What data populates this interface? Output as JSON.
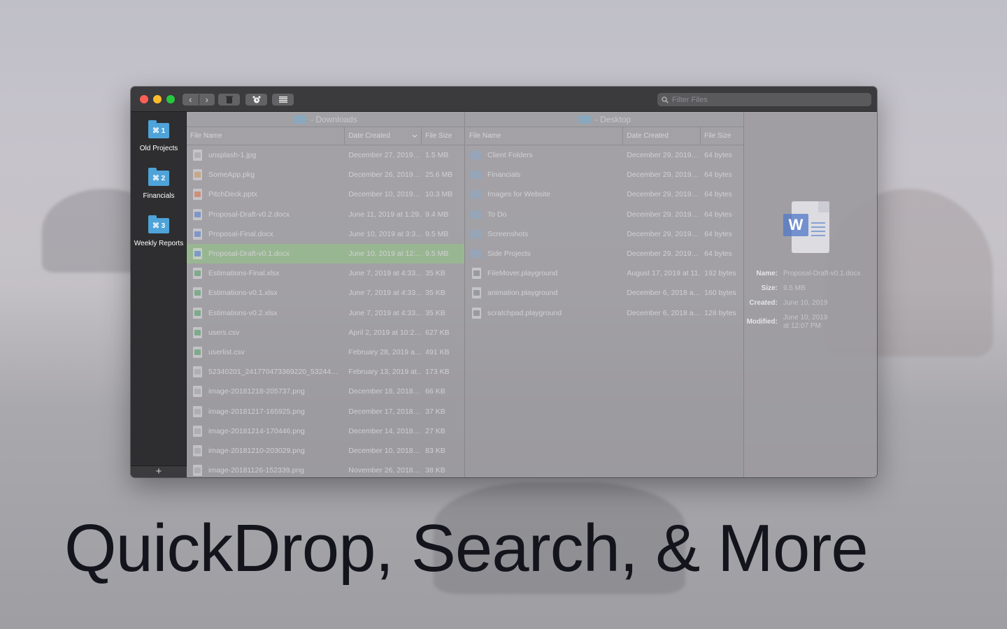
{
  "toolbar": {
    "search_placeholder": "Filter Files",
    "back_glyph": "‹",
    "forward_glyph": "›"
  },
  "sidebar": {
    "items": [
      {
        "shortcut": "⌘ 1",
        "label": "Old Projects"
      },
      {
        "shortcut": "⌘ 2",
        "label": "Financials"
      },
      {
        "shortcut": "⌘ 3",
        "label": "Weekly Reports"
      }
    ],
    "add_label": "+"
  },
  "left_pane": {
    "title": "- Downloads",
    "columns": {
      "name": "File Name",
      "date": "Date Created",
      "size": "File Size"
    },
    "rows": [
      {
        "name": "unsplash-1.jpg",
        "date": "December 27, 2019…",
        "size": "1.5 MB"
      },
      {
        "name": "SomeApp.pkg",
        "date": "December 26, 2019…",
        "size": "25.6 MB"
      },
      {
        "name": "PitchDeck.pptx",
        "date": "December 10, 2019…",
        "size": "10.3 MB"
      },
      {
        "name": "Proposal-Draft-v0.2.docx",
        "date": "June 11, 2019 at 1:29…",
        "size": "9.4 MB"
      },
      {
        "name": "Proposal-Final.docx",
        "date": "June 10, 2019 at 3:3…",
        "size": "9.5 MB"
      },
      {
        "name": "Proposal-Draft-v0.1.docx",
        "date": "June 10, 2019 at 12:…",
        "size": "9.5 MB"
      },
      {
        "name": "Estimations-Final.xlsx",
        "date": "June 7, 2019 at 4:33…",
        "size": "35 KB"
      },
      {
        "name": "Estimations-v0.1.xlsx",
        "date": "June 7, 2019 at 4:33…",
        "size": "35 KB"
      },
      {
        "name": "Estimations-v0.2.xlsx",
        "date": "June 7, 2019 at 4:33…",
        "size": "35 KB"
      },
      {
        "name": "users.csv",
        "date": "April 2, 2019 at 10:2…",
        "size": "627 KB"
      },
      {
        "name": "userlist.csv",
        "date": "February 28, 2019 a…",
        "size": "491 KB"
      },
      {
        "name": "52340201_241770473369220_53244…",
        "date": "February 13, 2019 at…",
        "size": "173 KB"
      },
      {
        "name": "image-20181218-205737.png",
        "date": "December 18, 2018…",
        "size": "66 KB"
      },
      {
        "name": "image-20181217-165925.png",
        "date": "December 17, 2018…",
        "size": "37 KB"
      },
      {
        "name": "image-20181214-170446.png",
        "date": "December 14, 2018…",
        "size": "27 KB"
      },
      {
        "name": "image-20181210-203029.png",
        "date": "December 10, 2018…",
        "size": "83 KB"
      },
      {
        "name": "image-20181126-152339.png",
        "date": "November 26, 2018…",
        "size": "38 KB"
      }
    ]
  },
  "right_pane": {
    "title": "- Desktop",
    "columns": {
      "name": "File Name",
      "date": "Date Created",
      "size": "File Size"
    },
    "rows": [
      {
        "name": "Client Folders",
        "date": "December 29, 2019…",
        "size": "64 bytes"
      },
      {
        "name": "Financials",
        "date": "December 29, 2019…",
        "size": "64 bytes"
      },
      {
        "name": "Images for Website",
        "date": "December 29, 2019…",
        "size": "64 bytes"
      },
      {
        "name": "To Do",
        "date": "December 29, 2019…",
        "size": "64 bytes"
      },
      {
        "name": "Screenshots",
        "date": "December 29, 2019…",
        "size": "64 bytes"
      },
      {
        "name": "Side Projects",
        "date": "December 29, 2019…",
        "size": "64 bytes"
      },
      {
        "name": "FileMover.playground",
        "date": "August 17, 2019 at 11…",
        "size": "192 bytes"
      },
      {
        "name": "animation.playground",
        "date": "December 6, 2018 a…",
        "size": "160 bytes"
      },
      {
        "name": "scratchpad.playground",
        "date": "December 6, 2018 a…",
        "size": "128 bytes"
      }
    ]
  },
  "info": {
    "icon_letter": "W",
    "name_label": "Name:",
    "name_value": "Proposal-Draft-v0.1.docx",
    "size_label": "Size:",
    "size_value": "9.5 MB",
    "created_label": "Created:",
    "created_value": "June 10, 2019",
    "modified_label": "Modified:",
    "modified_value": "June 10, 2019 at 12:07 PM"
  },
  "headline": "QuickDrop, Search, & More"
}
